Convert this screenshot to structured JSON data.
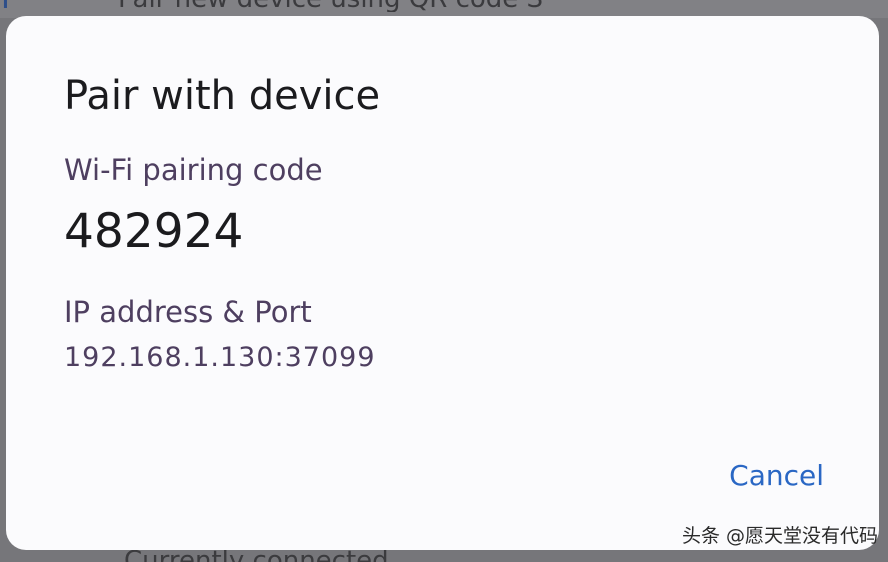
{
  "background": {
    "top_text": "Pair new device using QR code S",
    "bottom_text": "Currently connected",
    "top_glyph": "T"
  },
  "dialog": {
    "title": "Pair with device",
    "code_label": "Wi-Fi pairing code",
    "code_value": "482924",
    "ip_label": "IP address & Port",
    "ip_value": "192.168.1.130:37099",
    "cancel_label": "Cancel"
  },
  "watermark": "头条 @愿天堂没有代码",
  "colors": {
    "accent": "#2a67c4",
    "label": "#4e3f60",
    "text": "#1b1b1e",
    "dialog_bg": "#fbfbfd",
    "scrim": "#76767a"
  }
}
